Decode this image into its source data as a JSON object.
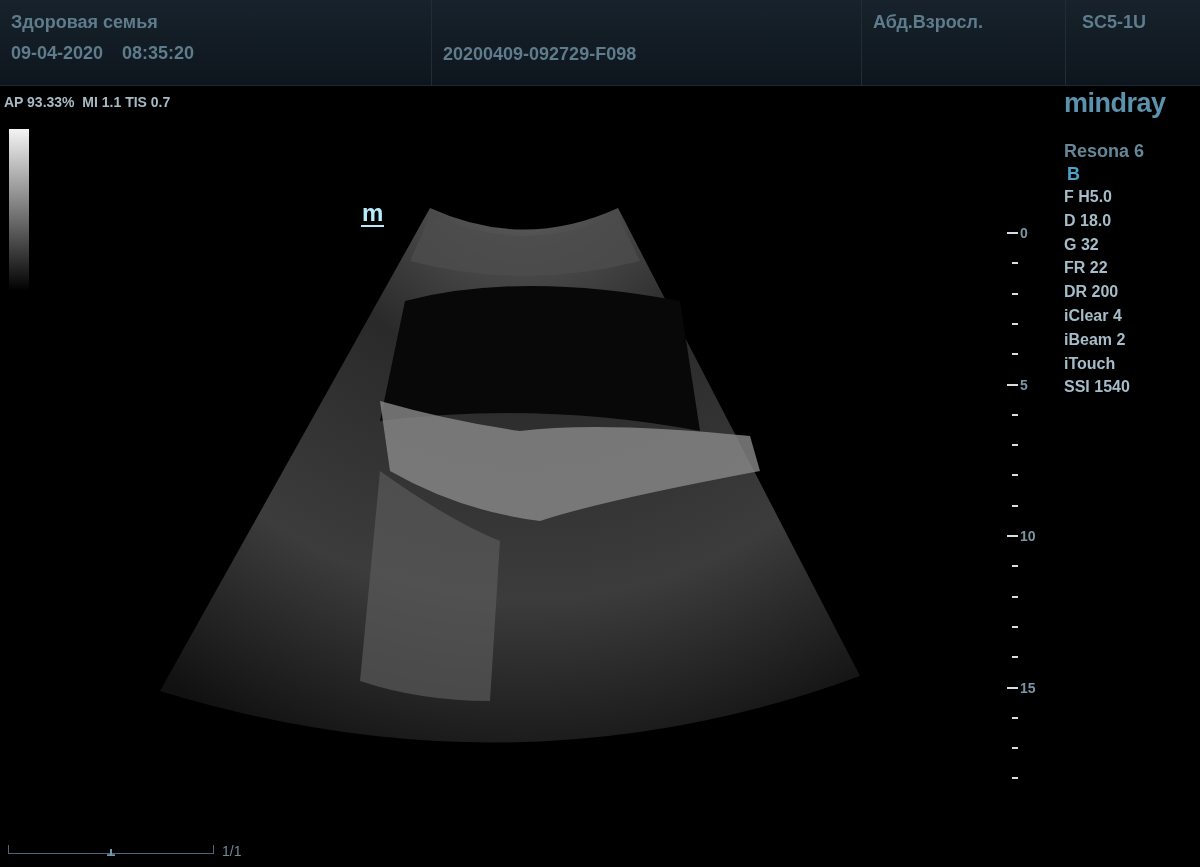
{
  "header": {
    "institution": "Здоровая семья",
    "date": "09-04-2020",
    "time": "08:35:20",
    "exam_id": "20200409-092729-F098",
    "preset": "Абд.Взросл.",
    "probe": "SC5-1U"
  },
  "acoustic_info": "AP 93.33%  MI 1.1 TIS 0.7",
  "orientation_marker": "m",
  "depth_scale": {
    "labels": [
      "0",
      "5",
      "10",
      "15"
    ]
  },
  "brand": "mindray",
  "model": "Resona 6",
  "mode": "B",
  "parameters": [
    "F H5.0",
    "D 18.0",
    "G 32",
    "FR 22",
    "DR 200",
    "iClear 4",
    "iBeam 2",
    "iTouch",
    "SSI 1540"
  ],
  "cine_bar": {
    "level": 0.5,
    "counter": "1/1"
  }
}
